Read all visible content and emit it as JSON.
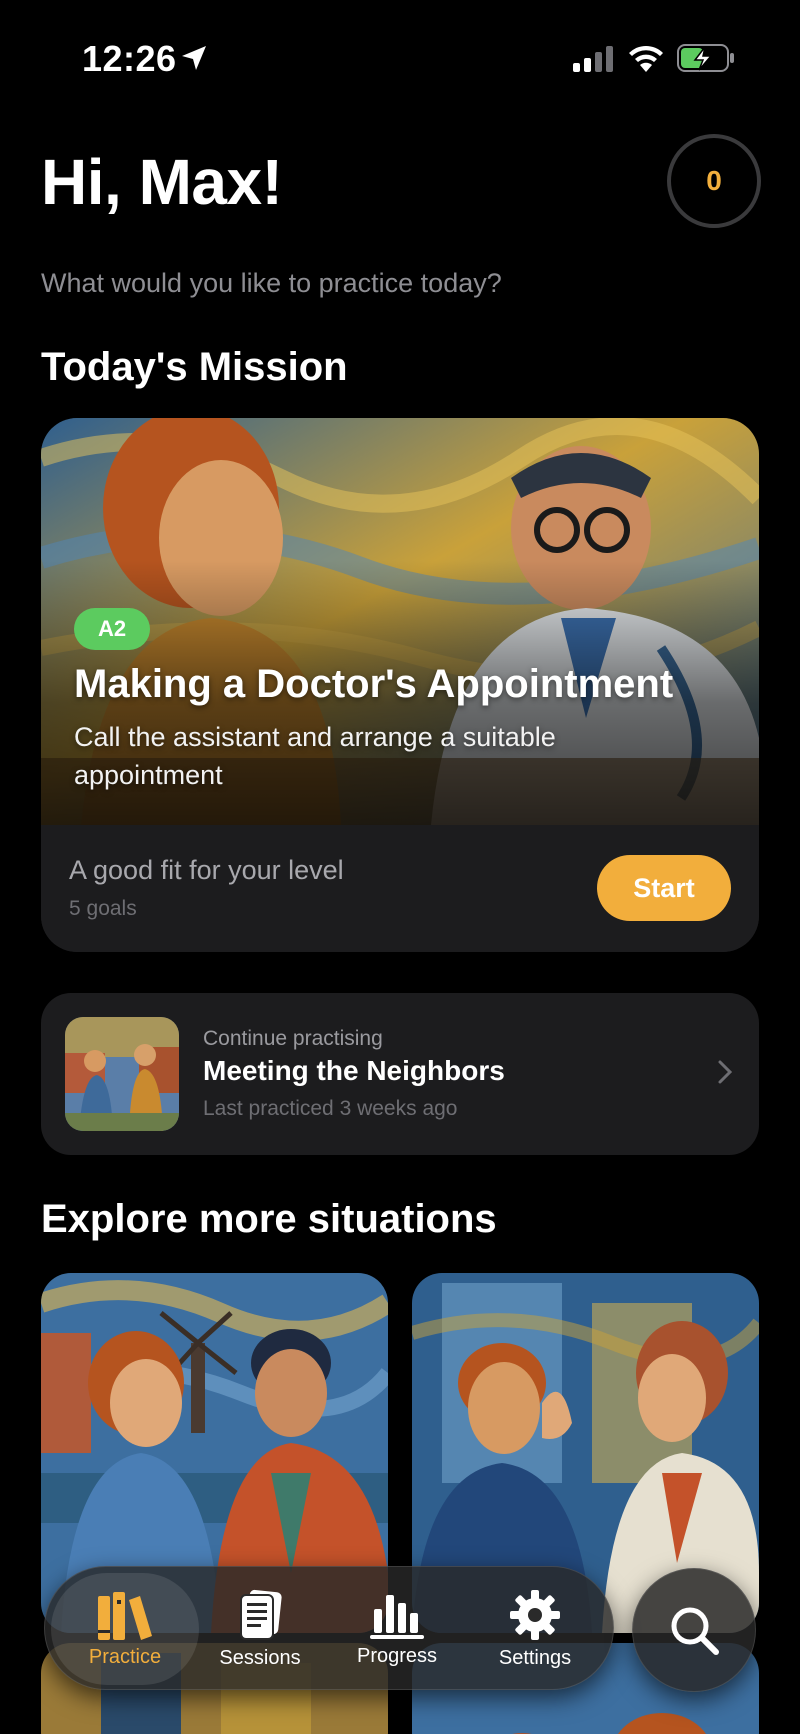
{
  "status_bar": {
    "time": "12:26",
    "icons": [
      "location-arrow-icon",
      "cellular-signal-icon",
      "wifi-icon",
      "battery-charging-icon"
    ]
  },
  "header": {
    "greeting": "Hi, Max!",
    "streak_count": "0",
    "subtitle": "What would you like to practice today?"
  },
  "mission": {
    "section_title": "Today's Mission",
    "level": "A2",
    "title": "Making a Doctor's Appointment",
    "description": "Call the assistant and arrange a suitable appointment",
    "fit_text": "A good fit for your level",
    "goals": "5 goals",
    "start_label": "Start",
    "accent_color": "#f2ae3c",
    "level_color": "#5ccb5f"
  },
  "continue": {
    "kicker": "Continue practising",
    "title": "Meeting the Neighbors",
    "meta": "Last practiced 3 weeks ago"
  },
  "explore": {
    "section_title": "Explore more situations"
  },
  "tab_bar": {
    "tabs": [
      {
        "label": "Practice",
        "icon": "books-icon",
        "active": true
      },
      {
        "label": "Sessions",
        "icon": "document-icon",
        "active": false
      },
      {
        "label": "Progress",
        "icon": "bar-chart-icon",
        "active": false
      },
      {
        "label": "Settings",
        "icon": "gear-icon",
        "active": false
      }
    ],
    "search_icon": "search-icon"
  }
}
